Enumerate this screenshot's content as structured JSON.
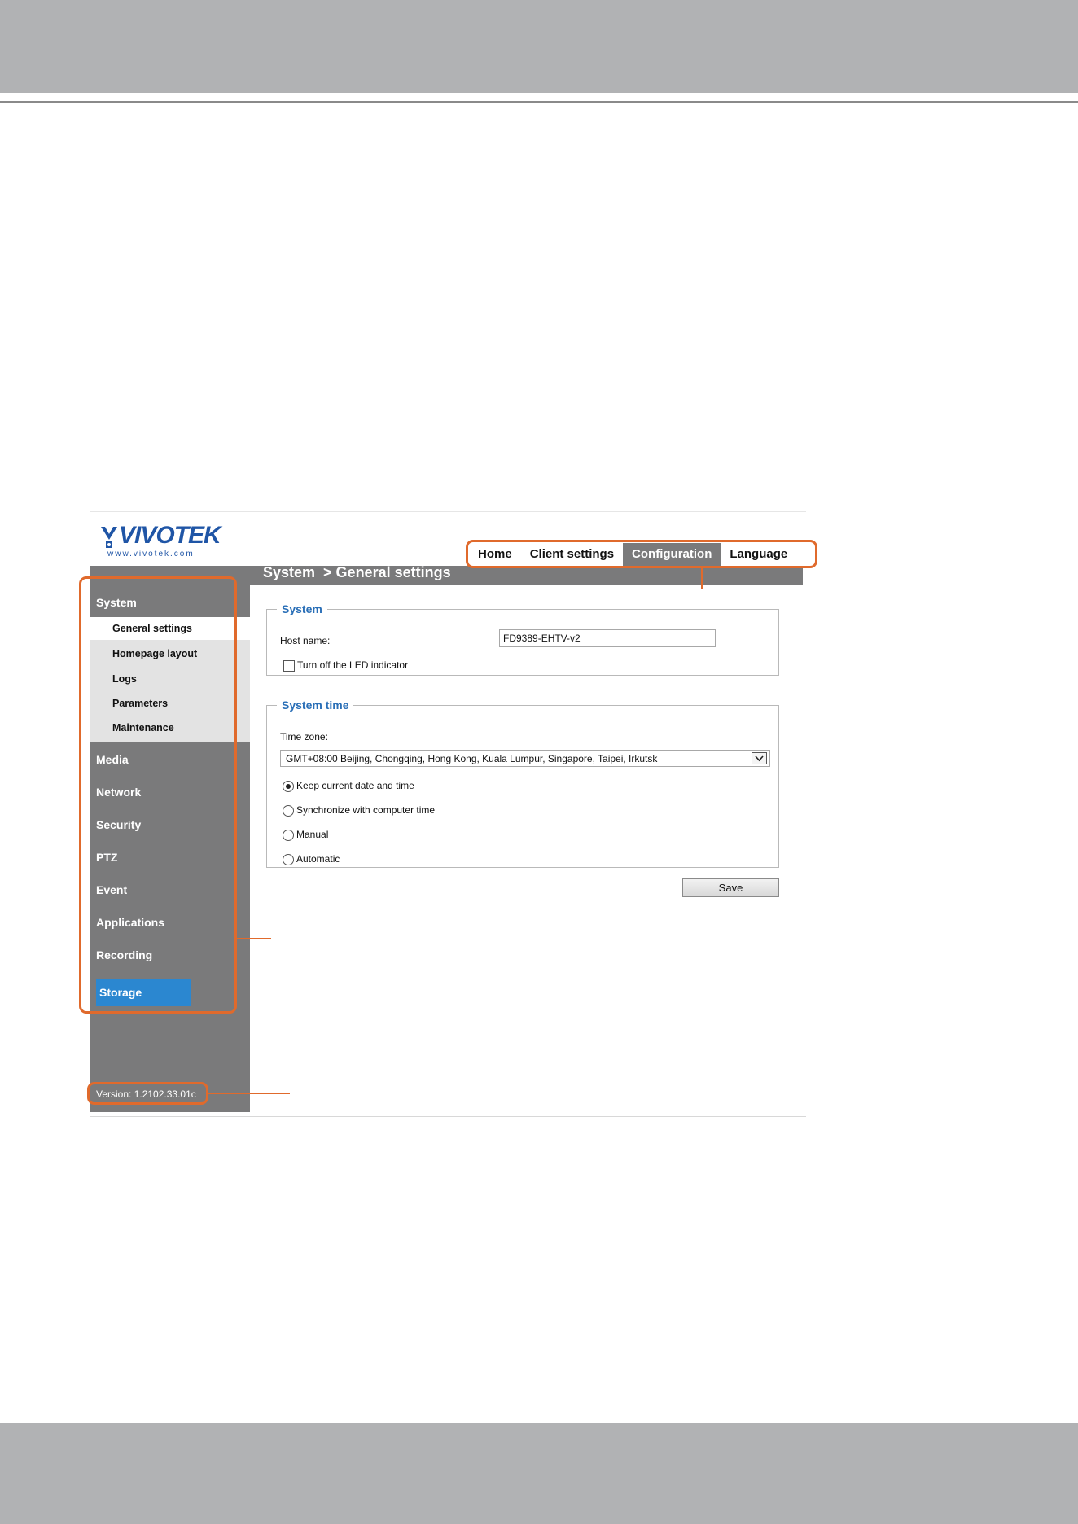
{
  "logo": {
    "word": "VIVOTEK",
    "url": "www.vivotek.com"
  },
  "top_nav": [
    {
      "label": "Home",
      "active": false
    },
    {
      "label": "Client settings",
      "active": false
    },
    {
      "label": "Configuration",
      "active": true
    },
    {
      "label": "Language",
      "active": false
    }
  ],
  "page_title": "System  > General settings",
  "sidebar": {
    "system_label": "System",
    "system_items": [
      {
        "label": "General settings",
        "active": true
      },
      {
        "label": "Homepage layout",
        "active": false
      },
      {
        "label": "Logs",
        "active": false
      },
      {
        "label": "Parameters",
        "active": false
      },
      {
        "label": "Maintenance",
        "active": false
      }
    ],
    "sections": [
      "Media",
      "Network",
      "Security",
      "PTZ",
      "Event",
      "Applications",
      "Recording"
    ],
    "storage_label": "Storage",
    "version": "Version: 1.2102.33.01c"
  },
  "system_group": {
    "legend": "System",
    "host_name_label": "Host name:",
    "host_name_value": "FD9389-EHTV-v2",
    "led_label": "Turn off the LED indicator",
    "led_checked": false
  },
  "time_group": {
    "legend": "System time",
    "time_zone_label": "Time zone:",
    "time_zone_value": "GMT+08:00 Beijing, Chongqing, Hong Kong, Kuala Lumpur, Singapore, Taipei, Irkutsk",
    "options": [
      {
        "label": "Keep current date and time",
        "checked": true
      },
      {
        "label": "Synchronize with computer time",
        "checked": false
      },
      {
        "label": "Manual",
        "checked": false
      },
      {
        "label": "Automatic",
        "checked": false
      }
    ]
  },
  "save_label": "Save",
  "colors": {
    "accent_blue": "#2b87d0",
    "legend_blue": "#2a6fb7",
    "sidebar_gray": "#7a7a7b",
    "callout_orange": "#e06a2c"
  }
}
